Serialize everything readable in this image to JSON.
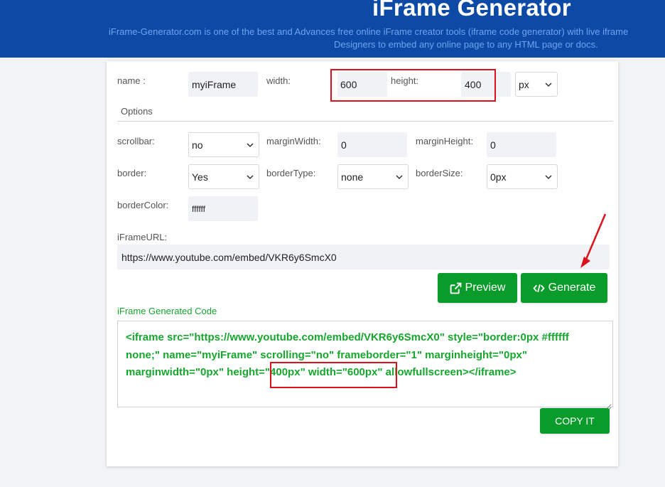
{
  "header": {
    "title": "iFrame Generator",
    "description_line1": "iFrame-Generator.com is one of the best and Advances free online iFrame creator tools (iframe code generator) with live iframe",
    "description_line2": "Designers to embed any online page to any HTML page or docs."
  },
  "form": {
    "name_label": "name :",
    "name_value": "myiFrame",
    "width_label": "width:",
    "width_value": "600",
    "height_label": "height:",
    "height_value": "400",
    "unit_value": "px",
    "options_heading": "Options",
    "scrollbar_label": "scrollbar:",
    "scrollbar_value": "no",
    "marginwidth_label": "marginWidth:",
    "marginwidth_value": "0",
    "marginheight_label": "marginHeight:",
    "marginheight_value": "0",
    "border_label": "border:",
    "border_value": "Yes",
    "bordertype_label": "borderType:",
    "bordertype_value": "none",
    "bordersize_label": "borderSize:",
    "bordersize_value": "0px",
    "bordercolor_label": "borderColor:",
    "bordercolor_value": "ffffff",
    "url_label": "iFrameURL:",
    "url_value": "https://www.youtube.com/embed/VKR6y6SmcX0"
  },
  "buttons": {
    "preview_label": "Preview",
    "generate_label": "Generate",
    "copy_label": "COPY IT"
  },
  "output": {
    "heading": "iFrame Generated Code",
    "line1": "<iframe src=\"https://www.youtube.com/embed/VKR6y6SmcX0\" style=\"border:0px #ffffff",
    "line2": "none;\" name=\"myiFrame\" scrolling=\"no\" frameborder=\"1\" marginheight=\"0px\"",
    "line3_a": "marginwidth=\"0px\" height=",
    "line3_b": "\"400px\" width=\"600px\"",
    "line3_c": " allowfullscreen></iframe>"
  },
  "colors": {
    "header_bg": "#0c4aa6",
    "button_green": "#0a9c2a",
    "code_green": "#17a62e",
    "annotation_red": "#d9121b"
  },
  "icons": {
    "preview": "external-link-icon",
    "generate": "code-icon",
    "select": "chevron-down-icon"
  }
}
